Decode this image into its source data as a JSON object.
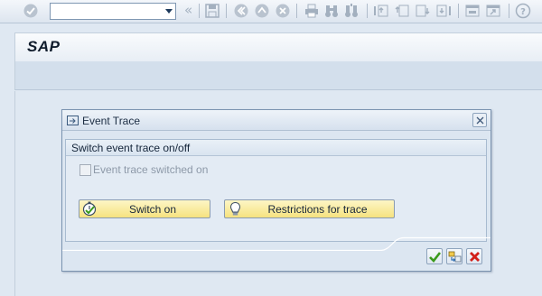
{
  "toolbar": {
    "command_field": {
      "value": "",
      "placeholder": ""
    },
    "icons": [
      "enter-icon",
      "save-icon",
      "back-icon",
      "exit-icon",
      "cancel-icon",
      "print-icon",
      "find-icon",
      "find-next-icon",
      "first-page-icon",
      "previous-page-icon",
      "next-page-icon",
      "last-page-icon",
      "create-session-icon",
      "shortcut-icon",
      "help-icon"
    ],
    "chevron": "«"
  },
  "app": {
    "title": "SAP"
  },
  "dialog": {
    "title": "Event Trace",
    "group_title": "Switch event trace on/off",
    "checkbox": {
      "label": "Event trace switched on",
      "checked": false,
      "enabled": false
    },
    "buttons": {
      "switch_on": "Switch on",
      "restrictions": "Restrictions for trace"
    },
    "footer_icons": [
      "confirm-icon",
      "continue-icon",
      "cancel-icon"
    ]
  },
  "colors": {
    "button_bg": "#f6e27f",
    "confirm_green": "#3a9a1c",
    "cancel_red": "#d2201a",
    "dialog_bg": "#dce6f1"
  }
}
